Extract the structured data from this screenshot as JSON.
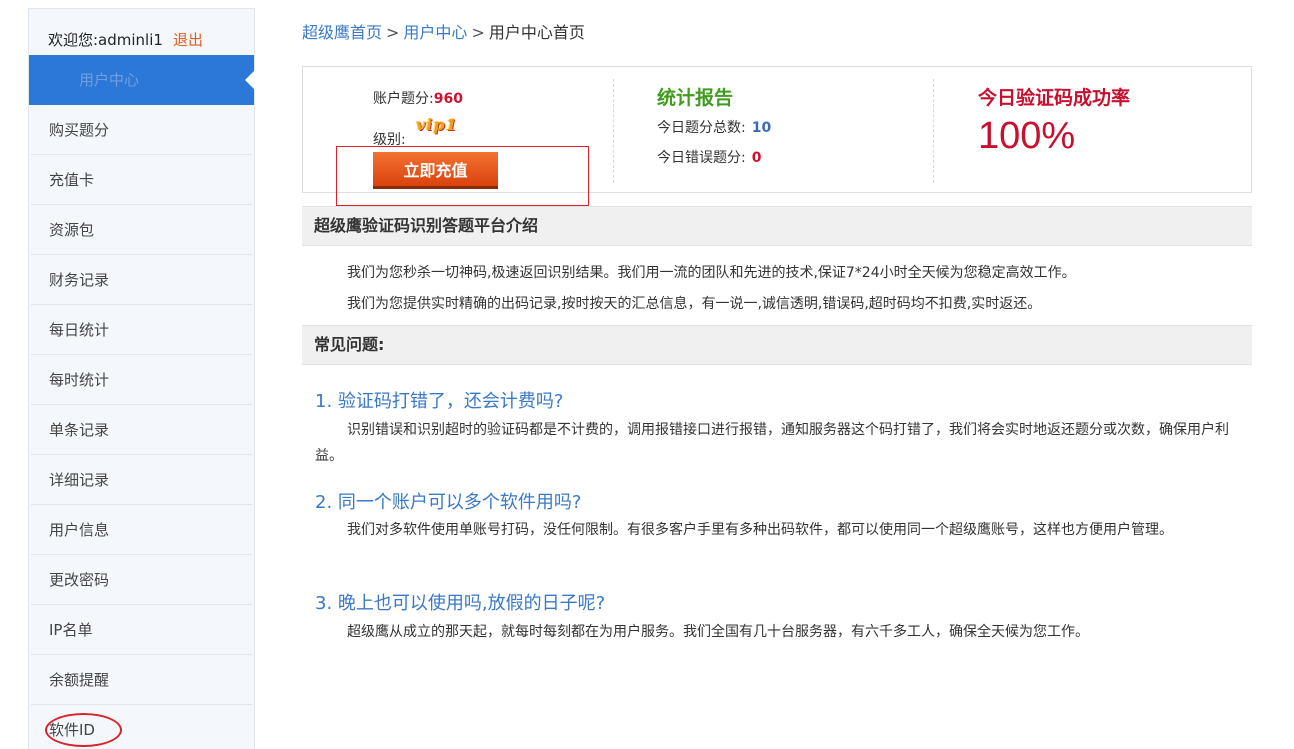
{
  "sidebar": {
    "welcome_prefix": "欢迎您:adminli1",
    "logout": "退出",
    "active_item": "用户中心",
    "items": [
      {
        "label": "购买题分"
      },
      {
        "label": "充值卡"
      },
      {
        "label": "资源包"
      },
      {
        "label": "财务记录"
      },
      {
        "label": "每日统计"
      },
      {
        "label": "每时统计"
      },
      {
        "label": "单条记录"
      },
      {
        "label": "详细记录"
      },
      {
        "label": "用户信息"
      },
      {
        "label": "更改密码"
      },
      {
        "label": "IP名单"
      },
      {
        "label": "余额提醒"
      },
      {
        "label": "软件ID"
      }
    ]
  },
  "breadcrumb": {
    "home": "超级鹰首页",
    "user_center": "用户中心",
    "current": "用户中心首页",
    "sep1": ">",
    "sep2": ">"
  },
  "account": {
    "balance_label": "账户题分:",
    "balance_value": "960",
    "level_label": "级别:",
    "level_badge": "vip1",
    "recharge_button": "立即充值"
  },
  "report": {
    "title": "统计报告",
    "today_total_label": "今日题分总数:",
    "today_total_value": "10",
    "today_error_label": "今日错误题分:",
    "today_error_value": "0"
  },
  "success_rate": {
    "title": "今日验证码成功率",
    "value": "100%"
  },
  "intro": {
    "heading": "超级鹰验证码识别答题平台介绍",
    "p1": "我们为您秒杀一切神码,极速返回识别结果。我们用一流的团队和先进的技术,保证7*24小时全天候为您稳定高效工作。",
    "p2": "我们为您提供实时精确的出码记录,按时按天的汇总信息，有一说一,诚信透明,错误码,超时码均不扣费,实时返还。"
  },
  "faq": {
    "heading": "常见问题:",
    "items": [
      {
        "question": "1. 验证码打错了，还会计费吗?",
        "answer": "识别错误和识别超时的验证码都是不计费的，调用报错接口进行报错，通知服务器这个码打错了，我们将会实时地返还题分或次数，确保用户利益。"
      },
      {
        "question": "2. 同一个账户可以多个软件用吗?",
        "answer": "我们对多软件使用单账号打码，没任何限制。有很多客户手里有多种出码软件，都可以使用同一个超级鹰账号，这样也方便用户管理。"
      },
      {
        "question": "3. 晚上也可以使用吗,放假的日子呢?",
        "answer": "超级鹰从成立的那天起，就每时每刻都在为用户服务。我们全国有几十台服务器，有六千多工人，确保全天候为您工作。"
      }
    ]
  },
  "colors": {
    "accent_blue": "#2c78d8",
    "link_blue": "#3a79c7",
    "success_green": "#3f9c1e",
    "rate_red": "#c8102e",
    "button_orange": "#e2521a",
    "annotation_red": "#d9232c"
  }
}
